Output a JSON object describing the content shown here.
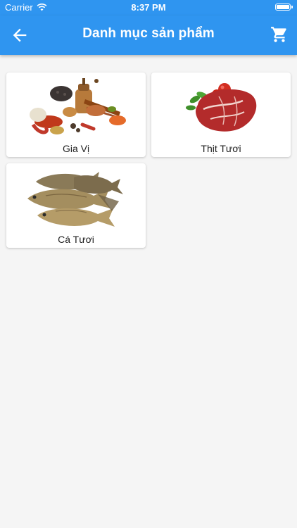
{
  "status_bar": {
    "carrier": "Carrier",
    "time": "8:37 PM"
  },
  "app_bar": {
    "title": "Danh mục sản phẩm",
    "back_icon": "arrow-back-icon",
    "cart_icon": "shopping-cart-icon"
  },
  "colors": {
    "primary": "#2f95f0",
    "background": "#f5f5f5",
    "card": "#ffffff"
  },
  "categories": [
    {
      "label": "Gia Vị",
      "image": "spices-image"
    },
    {
      "label": "Thịt Tươi",
      "image": "fresh-meat-image"
    },
    {
      "label": "Cá Tươi",
      "image": "fresh-fish-image"
    }
  ]
}
